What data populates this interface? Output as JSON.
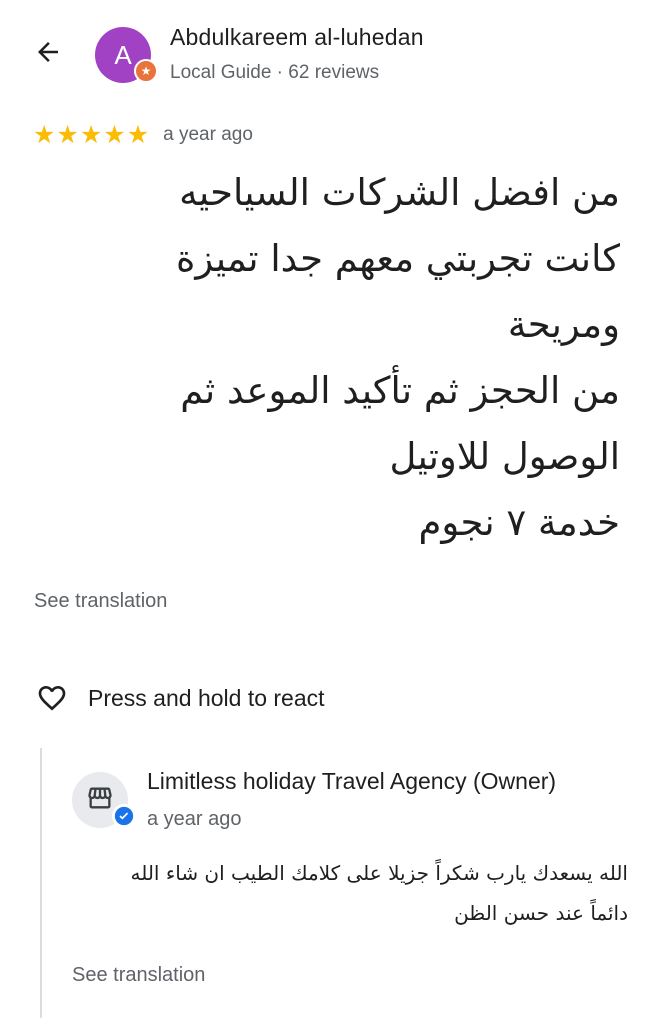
{
  "review": {
    "reviewer": {
      "name": "Abdulkareem al-luhedan",
      "avatar_letter": "A",
      "meta": "Local Guide · 62 reviews"
    },
    "rating": 5,
    "stars": [
      "★",
      "★",
      "★",
      "★",
      "★"
    ],
    "date": "a year ago",
    "text_lines": [
      "من افضل الشركات السياحيه",
      "كانت تجربتي معهم جدا تميزة",
      "ومريحة",
      "من الحجز ثم تأكيد الموعد ثم",
      "الوصول للاوتيل",
      "خدمة ٧ نجوم"
    ],
    "see_translation": "See translation"
  },
  "react": {
    "label": "Press and hold to react"
  },
  "owner_reply": {
    "name": "Limitless holiday Travel Agency (Owner)",
    "date": "a year ago",
    "text_lines": [
      "الله يسعدك يارب شكراً جزيلا على كلامك الطيب ان شاء الله",
      "دائماً عند حسن الظن"
    ],
    "see_translation": "See translation"
  },
  "icons": {
    "back": "arrow-back-icon",
    "guide_badge": "local-guide-star-icon",
    "heart": "heart-outline-icon",
    "store": "storefront-icon",
    "verified": "verified-check-icon"
  },
  "colors": {
    "avatar": "#a142c4",
    "guide_badge": "#e8743b",
    "star": "#fbbc04",
    "verified": "#1a73e8",
    "secondary_text": "#5f6368"
  }
}
